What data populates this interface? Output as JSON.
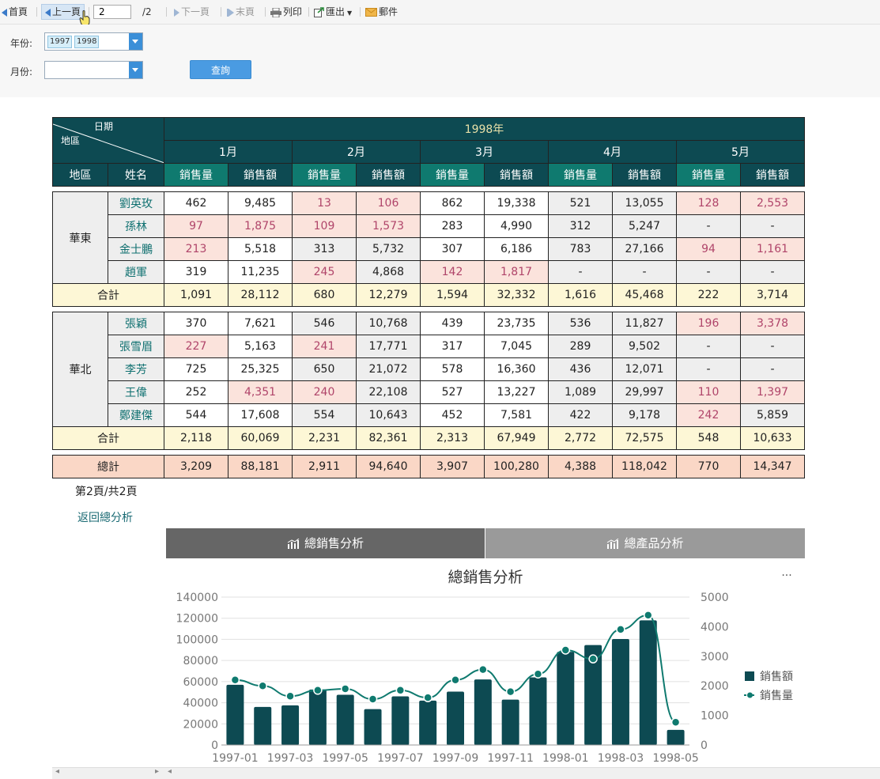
{
  "toolbar": {
    "first": "首頁",
    "prev": "上一頁",
    "page_value": "2",
    "page_total": "/2",
    "next": "下一頁",
    "last": "末頁",
    "print": "列印",
    "export": "匯出",
    "mail": "郵件"
  },
  "filters": {
    "year_label": "年份:",
    "years": [
      "1997",
      "1998"
    ],
    "month_label": "月份:",
    "query": "查詢"
  },
  "report": {
    "corner_top": "日期",
    "corner_bottom": "地區",
    "year": "1998年",
    "months": [
      "1月",
      "2月",
      "3月",
      "4月",
      "5月"
    ],
    "col_region": "地區",
    "col_name": "姓名",
    "col_qty": "銷售量",
    "col_amt": "銷售額",
    "regions": [
      {
        "name": "華東",
        "rows": [
          {
            "name": "劉英玫",
            "vals": [
              "462",
              "9,485",
              "13",
              "106",
              "862",
              "19,338",
              "521",
              "13,055",
              "128",
              "2,553"
            ]
          },
          {
            "name": "孫林",
            "vals": [
              "97",
              "1,875",
              "109",
              "1,573",
              "283",
              "4,990",
              "312",
              "5,247",
              "-",
              "-"
            ]
          },
          {
            "name": "金士鵬",
            "vals": [
              "213",
              "5,518",
              "313",
              "5,732",
              "307",
              "6,186",
              "783",
              "27,166",
              "94",
              "1,161"
            ]
          },
          {
            "name": "趙軍",
            "vals": [
              "319",
              "11,235",
              "245",
              "4,868",
              "142",
              "1,817",
              "-",
              "-",
              "-",
              "-"
            ]
          }
        ],
        "subtotal_label": "合計",
        "subtotal": [
          "1,091",
          "28,112",
          "680",
          "12,279",
          "1,594",
          "32,332",
          "1,616",
          "45,468",
          "222",
          "3,714"
        ]
      },
      {
        "name": "華北",
        "rows": [
          {
            "name": "張穎",
            "vals": [
              "370",
              "7,621",
              "546",
              "10,768",
              "439",
              "23,735",
              "536",
              "11,827",
              "196",
              "3,378"
            ]
          },
          {
            "name": "張雪眉",
            "vals": [
              "227",
              "5,163",
              "241",
              "17,771",
              "317",
              "7,045",
              "289",
              "9,502",
              "-",
              "-"
            ]
          },
          {
            "name": "李芳",
            "vals": [
              "725",
              "25,325",
              "650",
              "21,072",
              "578",
              "16,360",
              "436",
              "12,071",
              "-",
              "-"
            ]
          },
          {
            "name": "王偉",
            "vals": [
              "252",
              "4,351",
              "240",
              "22,108",
              "527",
              "13,227",
              "1,089",
              "29,997",
              "110",
              "1,397"
            ]
          },
          {
            "name": "鄭建傑",
            "vals": [
              "544",
              "17,608",
              "554",
              "10,643",
              "452",
              "7,581",
              "422",
              "9,178",
              "242",
              "5,859"
            ]
          }
        ],
        "subtotal_label": "合計",
        "subtotal": [
          "2,118",
          "60,069",
          "2,231",
          "82,361",
          "2,313",
          "67,949",
          "2,772",
          "72,575",
          "548",
          "10,633"
        ]
      }
    ],
    "grand_label": "總計",
    "grand": [
      "3,209",
      "88,181",
      "2,911",
      "94,640",
      "3,907",
      "100,280",
      "4,388",
      "118,042",
      "770",
      "14,347"
    ]
  },
  "page_info": "第2頁/共2頁",
  "back_link": "返回總分析",
  "tabs": [
    "總銷售分析",
    "總產品分析"
  ],
  "colors": {
    "header_dark": "#0d4a52",
    "header_teal": "#0f7a6f",
    "highlight_pink": "#fbe3dc",
    "subtotal_yellow": "#fdf7d6",
    "grand_peach": "#fad7c6",
    "bar": "#0d4a52",
    "line": "#0f7a6f"
  },
  "chart_data": {
    "type": "bar",
    "title": "總銷售分析",
    "x": [
      "1997-01",
      "1997-02",
      "1997-03",
      "1997-04",
      "1997-05",
      "1997-06",
      "1997-07",
      "1997-08",
      "1997-09",
      "1997-10",
      "1997-11",
      "1997-12",
      "1998-01",
      "1998-02",
      "1998-03",
      "1998-04",
      "1998-05"
    ],
    "x_tick_labels": [
      "1997-01",
      "1997-03",
      "1997-05",
      "1997-07",
      "1997-09",
      "1997-11",
      "1998-01",
      "1998-03",
      "1998-05"
    ],
    "ylim_left": [
      0,
      140000
    ],
    "yticks_left": [
      "0",
      "20000",
      "40000",
      "60000",
      "80000",
      "100000",
      "120000",
      "140000"
    ],
    "ylim_right": [
      0,
      5000
    ],
    "yticks_right": [
      "0",
      "1000",
      "2000",
      "3000",
      "4000",
      "5000"
    ],
    "series": [
      {
        "name": "銷售額",
        "type": "bar",
        "axis": "left",
        "values": [
          57000,
          36000,
          37500,
          52500,
          47500,
          34000,
          46000,
          42000,
          50500,
          62000,
          43000,
          64000,
          88181,
          94640,
          100280,
          118042,
          14347
        ]
      },
      {
        "name": "銷售量",
        "type": "line",
        "axis": "right",
        "values": [
          2200,
          2000,
          1650,
          1850,
          1900,
          1550,
          1850,
          1600,
          2200,
          2550,
          1800,
          2400,
          3209,
          2911,
          3907,
          4388,
          770
        ]
      }
    ],
    "legend": "right",
    "grid": true,
    "menu": "···"
  }
}
